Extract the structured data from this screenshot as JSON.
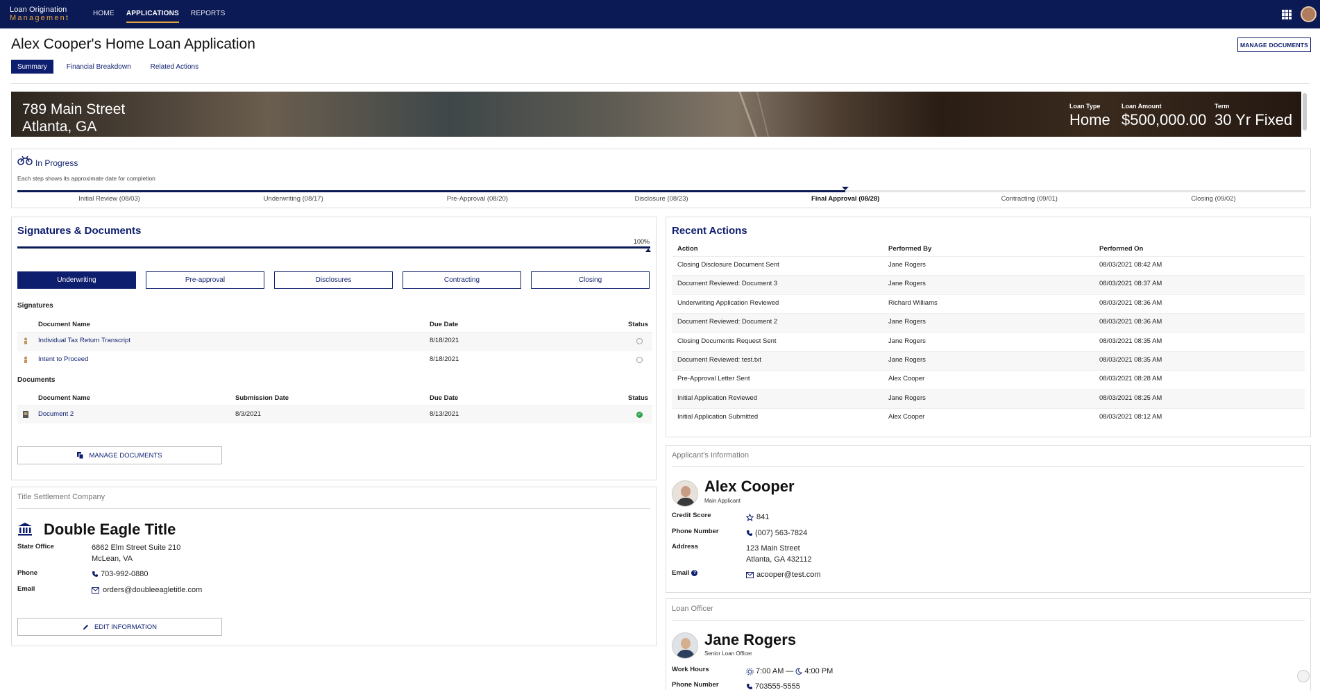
{
  "topbar": {
    "logo_line1": "Loan Origination",
    "logo_line2": "Management",
    "nav": [
      {
        "label": "HOME",
        "active": false
      },
      {
        "label": "APPLICATIONS",
        "active": true
      },
      {
        "label": "REPORTS",
        "active": false
      }
    ],
    "apps_icon": "grid-icon",
    "avatar": "user-avatar"
  },
  "header": {
    "title": "Alex Cooper's Home Loan Application",
    "manage_documents": "MANAGE DOCUMENTS",
    "tabs": [
      {
        "label": "Summary",
        "active": true
      },
      {
        "label": "Financial Breakdown",
        "active": false
      },
      {
        "label": "Related Actions",
        "active": false
      }
    ]
  },
  "hero": {
    "address_line1": "789 Main Street",
    "address_line2": "Atlanta, GA",
    "loan_type_label": "Loan Type",
    "loan_type": "Home",
    "loan_amount_label": "Loan Amount",
    "loan_amount": "$500,000.00",
    "term_label": "Term",
    "term": "30 Yr Fixed"
  },
  "progress": {
    "status": "In Progress",
    "note": "Each step shows its approximate date for completion",
    "current_step_index": 4,
    "steps": [
      "Initial Review (08/03)",
      "Underwriting (08/17)",
      "Pre-Approval (08/20)",
      "Disclosure (08/23)",
      "Final Approval (08/28)",
      "Contracting (09/01)",
      "Closing (09/02)"
    ]
  },
  "signatures": {
    "title": "Signatures & Documents",
    "percent_label": "100%",
    "percent": 100,
    "stages": [
      {
        "label": "Underwriting",
        "active": true
      },
      {
        "label": "Pre-approval",
        "active": false
      },
      {
        "label": "Disclosures",
        "active": false
      },
      {
        "label": "Contracting",
        "active": false
      },
      {
        "label": "Closing",
        "active": false
      }
    ],
    "sig_heading": "Signatures",
    "sig_cols": {
      "name": "Document Name",
      "due": "Due Date",
      "status": "Status"
    },
    "sig_rows": [
      {
        "name": "Individual Tax Return Transcript",
        "due": "8/18/2021",
        "status": "pending"
      },
      {
        "name": "Intent to Proceed",
        "due": "8/18/2021",
        "status": "pending"
      }
    ],
    "doc_heading": "Documents",
    "doc_cols": {
      "name": "Document Name",
      "submitted": "Submission Date",
      "due": "Due Date",
      "status": "Status"
    },
    "doc_rows": [
      {
        "name": "Document 2",
        "submitted": "8/3/2021",
        "due": "8/13/2021",
        "status": "complete"
      }
    ],
    "manage_button": "MANAGE DOCUMENTS"
  },
  "title_company": {
    "card_title": "Title Settlement Company",
    "name": "Double Eagle Title",
    "office_label": "State Office",
    "office_line1": "6862 Elm Street Suite 210",
    "office_line2": "McLean, VA",
    "phone_label": "Phone",
    "phone": "703-992-0880",
    "email_label": "Email",
    "email": "orders@doubleeagletitle.com",
    "edit_button": "EDIT INFORMATION"
  },
  "recent_actions": {
    "title": "Recent Actions",
    "cols": {
      "action": "Action",
      "by": "Performed By",
      "on": "Performed On"
    },
    "rows": [
      {
        "action": "Closing Disclosure Document Sent",
        "by": "Jane Rogers",
        "on": "08/03/2021 08:42 AM"
      },
      {
        "action": "Document Reviewed: Document 3",
        "by": "Jane Rogers",
        "on": "08/03/2021 08:37 AM"
      },
      {
        "action": "Underwriting Application Reviewed",
        "by": "Richard Williams",
        "on": "08/03/2021 08:36 AM"
      },
      {
        "action": "Document Reviewed: Document 2",
        "by": "Jane Rogers",
        "on": "08/03/2021 08:36 AM"
      },
      {
        "action": "Closing Documents Request Sent",
        "by": "Jane Rogers",
        "on": "08/03/2021 08:35 AM"
      },
      {
        "action": "Document Reviewed: test.txt",
        "by": "Jane Rogers",
        "on": "08/03/2021 08:35 AM"
      },
      {
        "action": "Pre-Approval Letter Sent",
        "by": "Alex Cooper",
        "on": "08/03/2021 08:28 AM"
      },
      {
        "action": "Initial Application Reviewed",
        "by": "Jane Rogers",
        "on": "08/03/2021 08:25 AM"
      },
      {
        "action": "Initial Application Submitted",
        "by": "Alex Cooper",
        "on": "08/03/2021 08:12 AM"
      }
    ]
  },
  "applicant": {
    "card_title": "Applicant's Information",
    "name": "Alex Cooper",
    "role": "Main Applicant",
    "credit_label": "Credit Score",
    "credit": "841",
    "phone_label": "Phone Number",
    "phone": "(007) 563-7824",
    "address_label": "Address",
    "address_line1": "123 Main Street",
    "address_line2": "Atlanta, GA 432112",
    "email_label": "Email",
    "email": "acooper@test.com"
  },
  "loan_officer": {
    "card_title": "Loan Officer",
    "name": "Jane Rogers",
    "role": "Senior Loan Officer",
    "hours_label": "Work Hours",
    "hours_start": "7:00 AM",
    "hours_sep": "—",
    "hours_end": "4:00 PM",
    "phone_label": "Phone Number",
    "phone": "703555-5555"
  },
  "colors": {
    "navy": "#0b1a55",
    "accent": "#e7a23b",
    "success": "#2fa34c"
  }
}
